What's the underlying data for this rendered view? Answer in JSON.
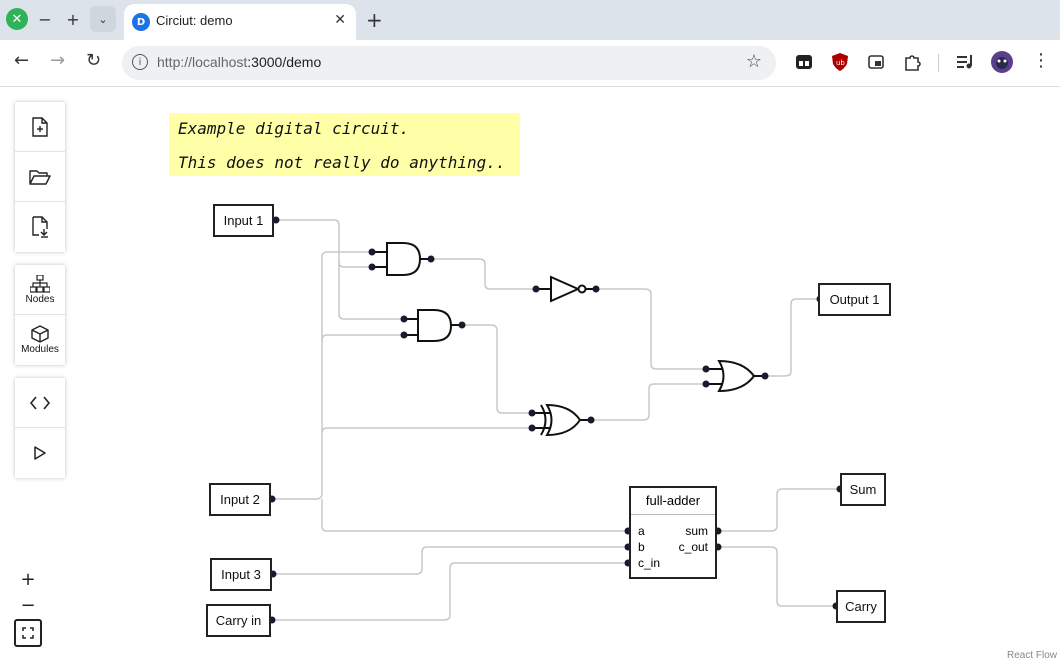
{
  "browser": {
    "tab_title": "Circiut: demo",
    "tab_icon": "D",
    "url_host": "http://localhost",
    "url_path": ":3000/demo"
  },
  "sidebar": {
    "file_buttons": [
      "new-file-icon",
      "open-folder-icon",
      "export-file-icon"
    ],
    "panels": [
      {
        "label": "Nodes",
        "icon": "nodes-icon"
      },
      {
        "label": "Modules",
        "icon": "modules-icon"
      }
    ],
    "actions": [
      "code-icon",
      "play-icon"
    ]
  },
  "zoom": {
    "in": "+",
    "out": "−"
  },
  "note": {
    "line1": "Example digital circuit.",
    "line2": "This does not really do anything.."
  },
  "nodes": {
    "input1": "Input 1",
    "input2": "Input 2",
    "input3": "Input 3",
    "carry_in": "Carry in",
    "output1": "Output 1",
    "sum": "Sum",
    "carry": "Carry"
  },
  "full_adder": {
    "title": "full-adder",
    "in_a": "a",
    "in_b": "b",
    "in_c": "c_in",
    "out_sum": "sum",
    "out_cout": "c_out"
  },
  "attribution": "React Flow",
  "colors": {
    "wire": "#c8c8c8",
    "note": "#ffffa8",
    "accent": "#1a73e8"
  }
}
